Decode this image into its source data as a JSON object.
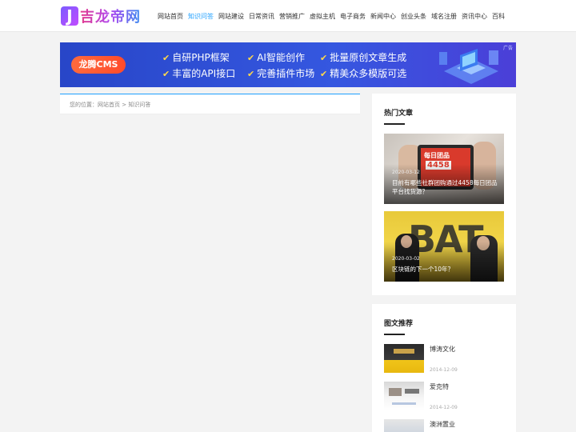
{
  "header": {
    "logo_j": "J",
    "logo_text": "吉龙帝网",
    "nav": [
      "网站首页",
      "知识问答",
      "网站建设",
      "日常资讯",
      "营销推广",
      "虚拟主机",
      "电子商务",
      "新闻中心",
      "创业头条",
      "域名注册",
      "资讯中心",
      "百科"
    ],
    "active_index": 1
  },
  "banner": {
    "logo": "龙腾CMS",
    "features": [
      "自研PHP框架",
      "AI智能创作",
      "批量原创文章生成",
      "丰富的API接口",
      "完善插件市场",
      "精美众多模版可选"
    ],
    "ad_label": "广告",
    "check_icon": "check-icon"
  },
  "breadcrumb": {
    "prefix": "您的位置：",
    "home": "网站首页",
    "sep": " > ",
    "current": "知识问答"
  },
  "hot": {
    "title": "热门文章",
    "items": [
      {
        "date": "2020-03-12",
        "title": "目前有哪些社群团购通过4458每日团品平台找货源？",
        "image_label": "每日团品",
        "image_number": "4458"
      },
      {
        "date": "2020-03-02",
        "title": "区块链的下一个10年？",
        "image_label": "BAT"
      }
    ]
  },
  "rec": {
    "title": "图文推荐",
    "items": [
      {
        "name": "博涛文化",
        "date": "2014-12-09"
      },
      {
        "name": "爱克特",
        "date": "2014-12-09"
      },
      {
        "name": "澳洲置业",
        "date": ""
      }
    ]
  },
  "colors": {
    "accent": "#1e9fff",
    "banner_bg": "#3557e0",
    "banner_logo": "#ff5a33"
  }
}
